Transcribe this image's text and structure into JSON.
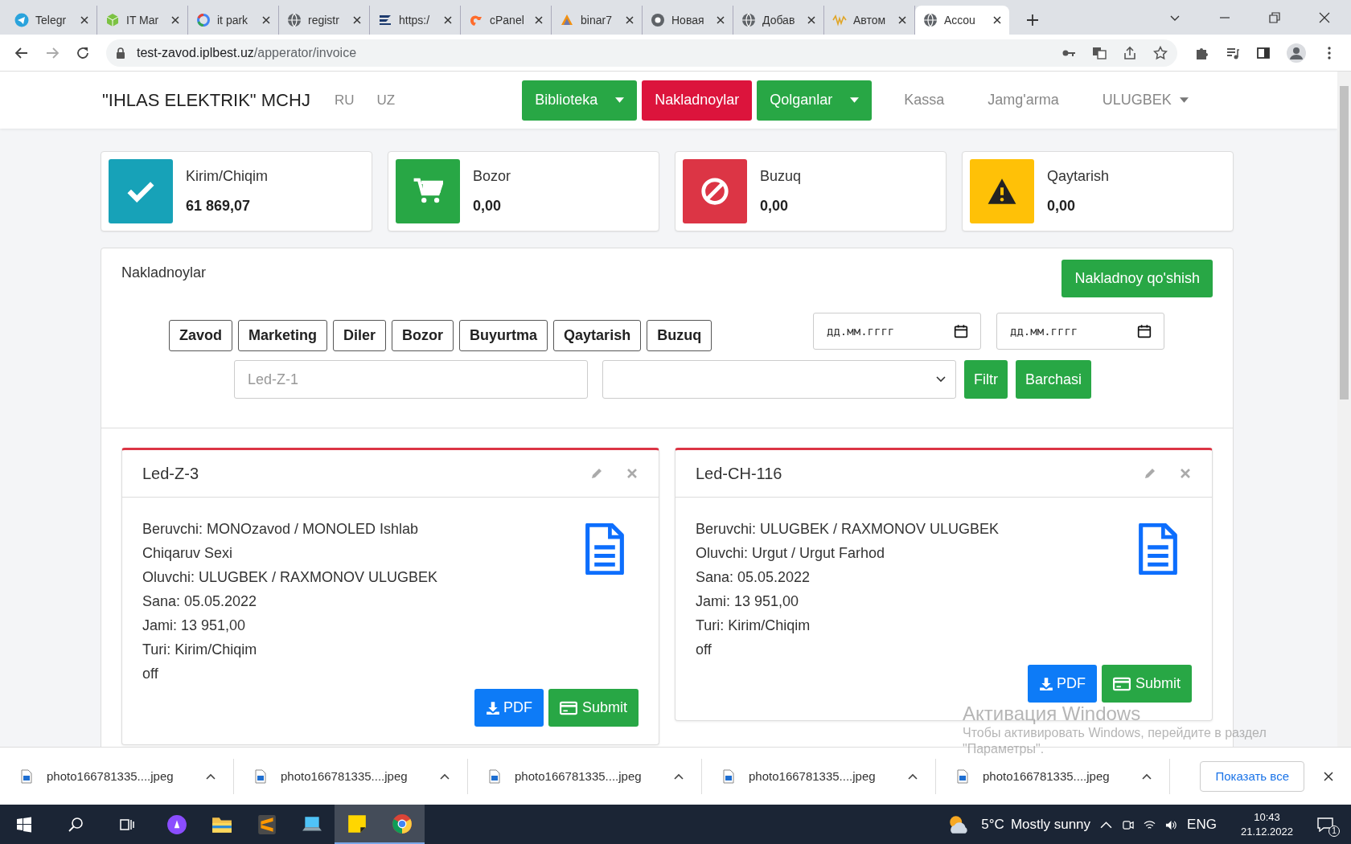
{
  "browser": {
    "tabs": [
      {
        "title": "Telegr",
        "kind": "plane",
        "selected": false
      },
      {
        "title": "IT Mar",
        "kind": "cube",
        "selected": false
      },
      {
        "title": "it park",
        "kind": "ring",
        "selected": false
      },
      {
        "title": "registr",
        "kind": "globe",
        "selected": false
      },
      {
        "title": "https:/",
        "kind": "stripes",
        "selected": false
      },
      {
        "title": "cPanel",
        "kind": "swirl",
        "selected": false
      },
      {
        "title": "binar7",
        "kind": "sail",
        "selected": false
      },
      {
        "title": "Новая",
        "kind": "wheel",
        "selected": false
      },
      {
        "title": "Добав",
        "kind": "globe",
        "selected": false
      },
      {
        "title": "Автом",
        "kind": "wave",
        "selected": false
      },
      {
        "title": "Accou",
        "kind": "globe",
        "selected": true
      }
    ],
    "address": {
      "domain": "test-zavod.iplbest.uz",
      "path": "/apperator/invoice"
    }
  },
  "navbar": {
    "brand": "\"IHLAS ELEKTRIK\" MCHJ",
    "languages": [
      "RU",
      "UZ"
    ],
    "items": [
      {
        "label": "Biblioteka",
        "kind": "dropdown",
        "color": "#28a745"
      },
      {
        "label": "Nakladnoylar",
        "kind": "button",
        "color": "#dc143c"
      },
      {
        "label": "Qolganlar",
        "kind": "dropdown",
        "color": "#28a745"
      },
      {
        "label": "Kassa",
        "kind": "link"
      },
      {
        "label": "Jamg'arma",
        "kind": "link"
      },
      {
        "label": "ULUGBEK",
        "kind": "menu"
      }
    ]
  },
  "stats": [
    {
      "label": "Kirim/Chiqim",
      "value": "61 869,07",
      "kind": "check",
      "color": "#17a2b8"
    },
    {
      "label": "Bozor",
      "value": "0,00",
      "kind": "cart",
      "color": "#28a745"
    },
    {
      "label": "Buzuq",
      "value": "0,00",
      "kind": "ban",
      "color": "#dc3545"
    },
    {
      "label": "Qaytarish",
      "value": "0,00",
      "kind": "warning",
      "color": "#ffc107"
    }
  ],
  "panel": {
    "title": "Nakladnoylar",
    "add_button": "Nakladnoy qo'shish",
    "filters": [
      "Zavod",
      "Marketing",
      "Diler",
      "Bozor",
      "Buyurtma",
      "Qaytarish",
      "Buzuq"
    ],
    "date_fields": [
      {
        "placeholder": "дд.мм.гггг"
      },
      {
        "placeholder": "дд.мм.гггг"
      }
    ],
    "search": {
      "placeholder": "Led-Z-1"
    },
    "buttons": [
      "Filtr",
      "Barchasi"
    ],
    "invoices": [
      {
        "title": "Led-Z-3",
        "lines": [
          "Beruvchi: MONOzavod / MONOLED Ishlab Chiqaruv Sexi",
          "Oluvchi: ULUGBEK / RAXMONOV ULUGBEK",
          "Sana: 05.05.2022",
          "Jami: 13 951,00",
          "Turi: Kirim/Chiqim",
          "off"
        ],
        "pdf": "PDF",
        "submit": "Submit"
      },
      {
        "title": "Led-CH-116",
        "lines": [
          "Beruvchi: ULUGBEK / RAXMONOV ULUGBEK",
          "Oluvchi: Urgut / Urgut Farhod",
          "Sana: 05.05.2022",
          "Jami: 13 951,00",
          "Turi: Kirim/Chiqim",
          "off"
        ],
        "pdf": "PDF",
        "submit": "Submit"
      }
    ]
  },
  "overlay": {
    "title": "Активация Windows",
    "lines": [
      "Чтобы активировать Windows, перейдите в раздел",
      "\"Параметры\"."
    ]
  },
  "downloads": {
    "files": [
      "photo166781335....jpeg",
      "photo166781335....jpeg",
      "photo166781335....jpeg",
      "photo166781335....jpeg",
      "photo166781335....jpeg"
    ],
    "show_all": "Показать все"
  },
  "taskbar": {
    "apps": [
      {
        "kind": "alice",
        "selected": false
      },
      {
        "kind": "folder",
        "selected": false
      },
      {
        "kind": "sublime",
        "selected": false
      },
      {
        "kind": "computer",
        "selected": false
      },
      {
        "kind": "notes",
        "selected": true
      },
      {
        "kind": "chrome",
        "selected": true
      }
    ],
    "temperature": "5°C",
    "weather": "Mostly sunny",
    "language": "ENG",
    "time": "10:43",
    "date": "21.12.2022",
    "notifications": "1"
  }
}
